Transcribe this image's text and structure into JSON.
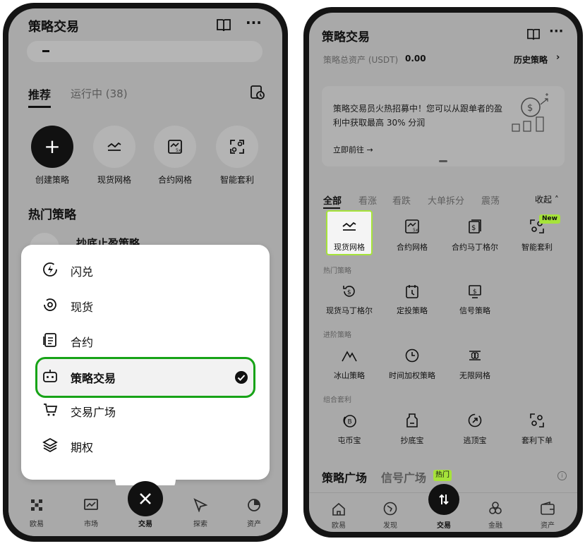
{
  "left": {
    "header_title": "策略交易",
    "tabs": [
      "推荐",
      "运行中 (38)"
    ],
    "quick_actions": [
      "创建策略",
      "现货网格",
      "合约网格",
      "智能套利"
    ],
    "section_title": "热门策略",
    "peek_text": "抄底止盈策略",
    "menu": {
      "items": [
        "闪兑",
        "现货",
        "合约",
        "策略交易",
        "交易广场",
        "期权"
      ],
      "selected_index": 3
    },
    "bottom_nav": [
      "欧易",
      "市场",
      "交易",
      "探索",
      "资产"
    ]
  },
  "right": {
    "header_title": "策略交易",
    "total_label": "策略总资产 (USDT)",
    "total_value": "0.00",
    "history_link": "历史策略",
    "banner_text": "策略交易员火热招募中！您可以从跟单者的盈利中获取最高 30% 分润",
    "banner_link": "立即前往",
    "filter_tabs": [
      "全部",
      "看涨",
      "看跌",
      "大单拆分",
      "震荡"
    ],
    "collapse_label": "收起",
    "row1": [
      "现货网格",
      "合约网格",
      "合约马丁格尔",
      "智能套利"
    ],
    "new_badge": "New",
    "section_hot": "热门策略",
    "hot": [
      "现货马丁格尔",
      "定投策略",
      "信号策略"
    ],
    "section_advanced": "进阶策略",
    "advanced": [
      "冰山策略",
      "时间加权策略",
      "无限网格"
    ],
    "section_combo": "组合套利",
    "combo": [
      "屯币宝",
      "抄底宝",
      "逃顶宝",
      "套利下单"
    ],
    "plaza_tab": "策略广场",
    "signal_tab": "信号广场",
    "hot_badge": "热门",
    "bottom_nav": [
      "欧易",
      "发现",
      "交易",
      "金融",
      "资产"
    ]
  },
  "colors": {
    "highlight_green": "#17a317",
    "badge_green": "#a6e33a",
    "dim_gray": "#a9a9a9"
  }
}
